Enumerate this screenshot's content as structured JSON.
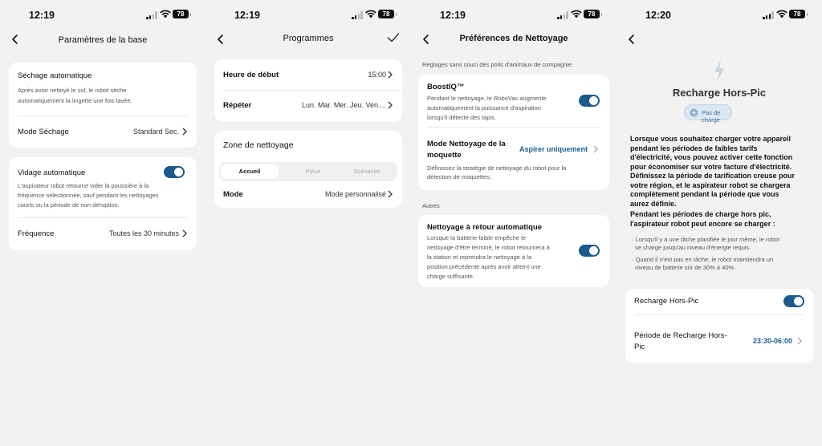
{
  "status": {
    "battery": "78"
  },
  "screens": [
    {
      "time": "12:19",
      "title": "Paramètres de la base",
      "auto_dry": {
        "title": "Séchage automatique",
        "desc_l1": "Après avoir nettoyé le sol, le robot sèche",
        "desc_l2": "automatiquement la lingette une fois lavée.",
        "mode_label": "Mode Séchage",
        "mode_value": "Standard Sec."
      },
      "auto_empty": {
        "title": "Vidage automatique",
        "desc_l1": "L'aspirateur robot retourne vider la poussière à la",
        "desc_l2": "fréquence sélectionnée, sauf pendant les nettoyages",
        "desc_l3": "courts ou la période de non-déruption.",
        "freq_label": "Fréquence",
        "freq_value": "Toutes les 30 minutes"
      }
    },
    {
      "time": "12:19",
      "title": "Programmes",
      "start_label": "Heure de début",
      "start_value": "15:00",
      "repeat_label": "Répéter",
      "repeat_value": "Lun. Mar. Mer. Jeu. Ven....",
      "zone_title": "Zone de nettoyage",
      "tabs": [
        "Accueil",
        "Pièce",
        "Scénarios"
      ],
      "mode_label": "Mode",
      "mode_value": "Mode personnalisé"
    },
    {
      "time": "12:19",
      "title": "Préférences de Nettoyage",
      "intro": "Réglages sans souci des poils d'animaux de compagnie.",
      "boost": {
        "title": "BoostIQ™",
        "desc_l1": "Pendant le nettoyage, le RoboVac augmente",
        "desc_l2": "automatiquement la puissance d'aspiration",
        "desc_l3": "lorsqu'il détecte des tapis."
      },
      "carpet": {
        "title_l1": "Mode Nettoyage de la",
        "title_l2": "moquette",
        "value": "Aspirer uniquement",
        "desc_l1": "Définissez la stratégie de nettoyage du robot pour la",
        "desc_l2": "détection de moquettes."
      },
      "others": "Autres",
      "return": {
        "title": "Nettoyage à retour automatique",
        "desc_l1": "Lorsque la batterie faible empêche le",
        "desc_l2": "nettoyage d'être terminé, le robot retournera à",
        "desc_l3": "la station et reprendra le nettoyage à la",
        "desc_l4": "position précédente après avoir atteint une",
        "desc_l5": "charge suffisante."
      }
    },
    {
      "time": "12:20",
      "title": "Recharge Hors-Pic",
      "badge": "Pas de charge",
      "p1": [
        "Lorsque vous souhaitez charger votre appareil",
        "pendant les périodes de faibles tarifs",
        "d'électricité, vous pouvez activer cette fonction",
        "pour économiser sur votre facture d'électricité.",
        "Définissez la période de tarification creuse pour",
        "votre région, et le aspirateur robot se chargera",
        "complètement pendant la période que vous",
        "aurez définie."
      ],
      "p2": [
        "Pendant les périodes de charge hors pic,",
        "l'aspirateur robot peut encore se charger :"
      ],
      "b1": [
        "· Lorsqu'il y a une tâche planifiée le jour même, le robot",
        "  se charge jusqu'au niveau d'énergie requis."
      ],
      "b2": [
        "· Quand il n'est pas en tâche, le robot maintiendra un",
        "  niveau de batterie sûr de 30% à 40%."
      ],
      "toggle_label": "Recharge Hors-Pic",
      "period_label_l1": "Période de Recharge Hors-",
      "period_label_l2": "Pic",
      "period_value": "23:30-06:00"
    }
  ],
  "colors": {
    "accent": "#1a5a8c",
    "link": "#1d5d94",
    "bg": "#f2f2f2"
  }
}
